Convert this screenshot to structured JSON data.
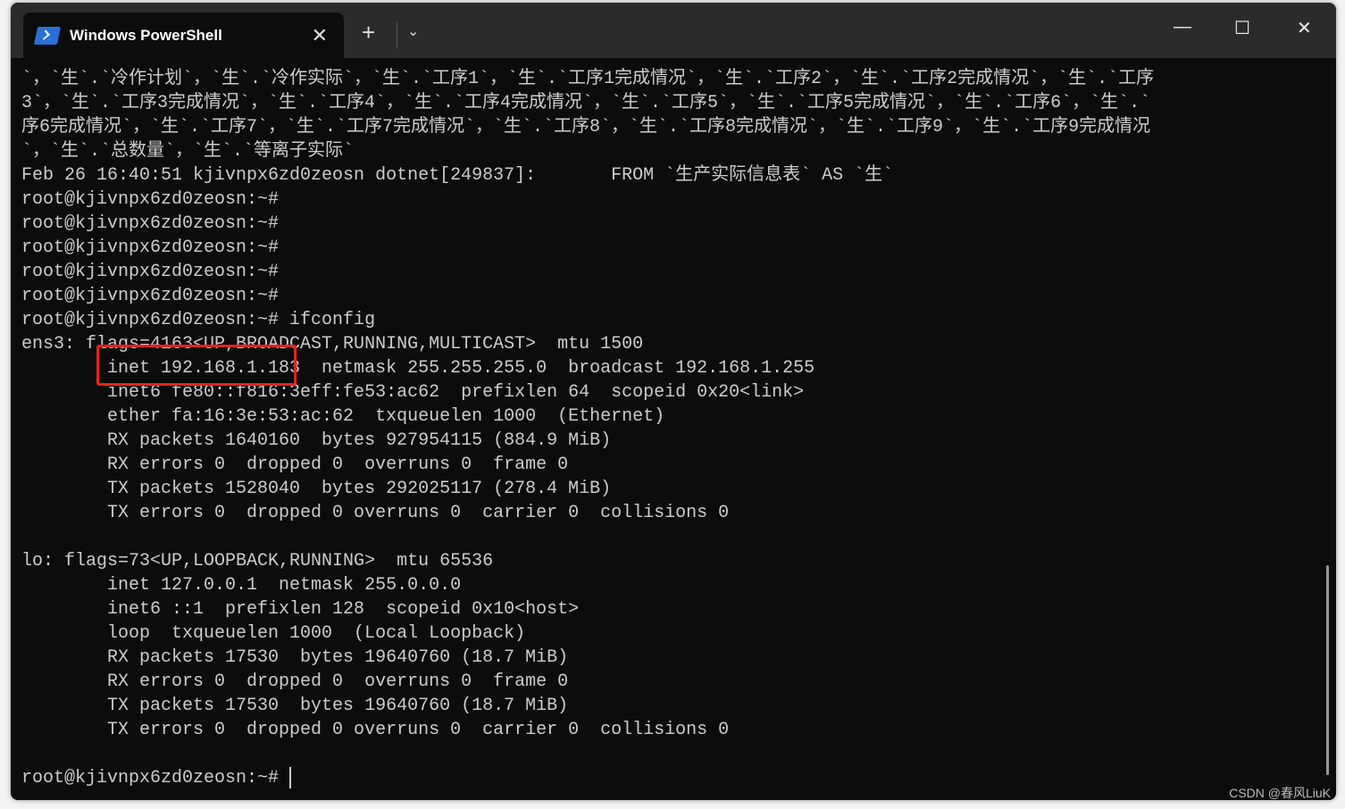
{
  "window": {
    "tab_title": "Windows PowerShell",
    "new_tab": "+",
    "dropdown": "⌄",
    "minimize": "—",
    "maximize": "☐",
    "close": "✕",
    "tab_close": "✕"
  },
  "terminal": {
    "lines": [
      "`，`生`.`冷作计划`，`生`.`冷作实际`，`生`.`工序1`，`生`.`工序1完成情况`，`生`.`工序2`，`生`.`工序2完成情况`，`生`.`工序",
      "3`，`生`.`工序3完成情况`，`生`.`工序4`，`生`.`工序4完成情况`，`生`.`工序5`，`生`.`工序5完成情况`，`生`.`工序6`，`生`.`",
      "序6完成情况`，`生`.`工序7`，`生`.`工序7完成情况`，`生`.`工序8`，`生`.`工序8完成情况`，`生`.`工序9`，`生`.`工序9完成情况",
      "`，`生`.`总数量`，`生`.`等离子实际`",
      "Feb 26 16:40:51 kjivnpx6zd0zeosn dotnet[249837]:       FROM `生产实际信息表` AS `生`",
      "root@kjivnpx6zd0zeosn:~#",
      "root@kjivnpx6zd0zeosn:~#",
      "root@kjivnpx6zd0zeosn:~#",
      "root@kjivnpx6zd0zeosn:~#",
      "root@kjivnpx6zd0zeosn:~#",
      "root@kjivnpx6zd0zeosn:~# ifconfig",
      "ens3: flags=4163<UP,BROADCAST,RUNNING,MULTICAST>  mtu 1500",
      "        inet 192.168.1.183  netmask 255.255.255.0  broadcast 192.168.1.255",
      "        inet6 fe80::f816:3eff:fe53:ac62  prefixlen 64  scopeid 0x20<link>",
      "        ether fa:16:3e:53:ac:62  txqueuelen 1000  (Ethernet)",
      "        RX packets 1640160  bytes 927954115 (884.9 MiB)",
      "        RX errors 0  dropped 0  overruns 0  frame 0",
      "        TX packets 1528040  bytes 292025117 (278.4 MiB)",
      "        TX errors 0  dropped 0 overruns 0  carrier 0  collisions 0",
      "",
      "lo: flags=73<UP,LOOPBACK,RUNNING>  mtu 65536",
      "        inet 127.0.0.1  netmask 255.0.0.0",
      "        inet6 ::1  prefixlen 128  scopeid 0x10<host>",
      "        loop  txqueuelen 1000  (Local Loopback)",
      "        RX packets 17530  bytes 19640760 (18.7 MiB)",
      "        RX errors 0  dropped 0  overruns 0  frame 0",
      "        TX packets 17530  bytes 19640760 (18.7 MiB)",
      "        TX errors 0  dropped 0 overruns 0  carrier 0  collisions 0",
      "",
      "root@kjivnpx6zd0zeosn:~# "
    ]
  },
  "watermark": "CSDN @春风LiuK",
  "colors": {
    "highlight": "#e8211c",
    "terminal_bg": "#0c0c0c",
    "terminal_fg": "#cccccc"
  }
}
